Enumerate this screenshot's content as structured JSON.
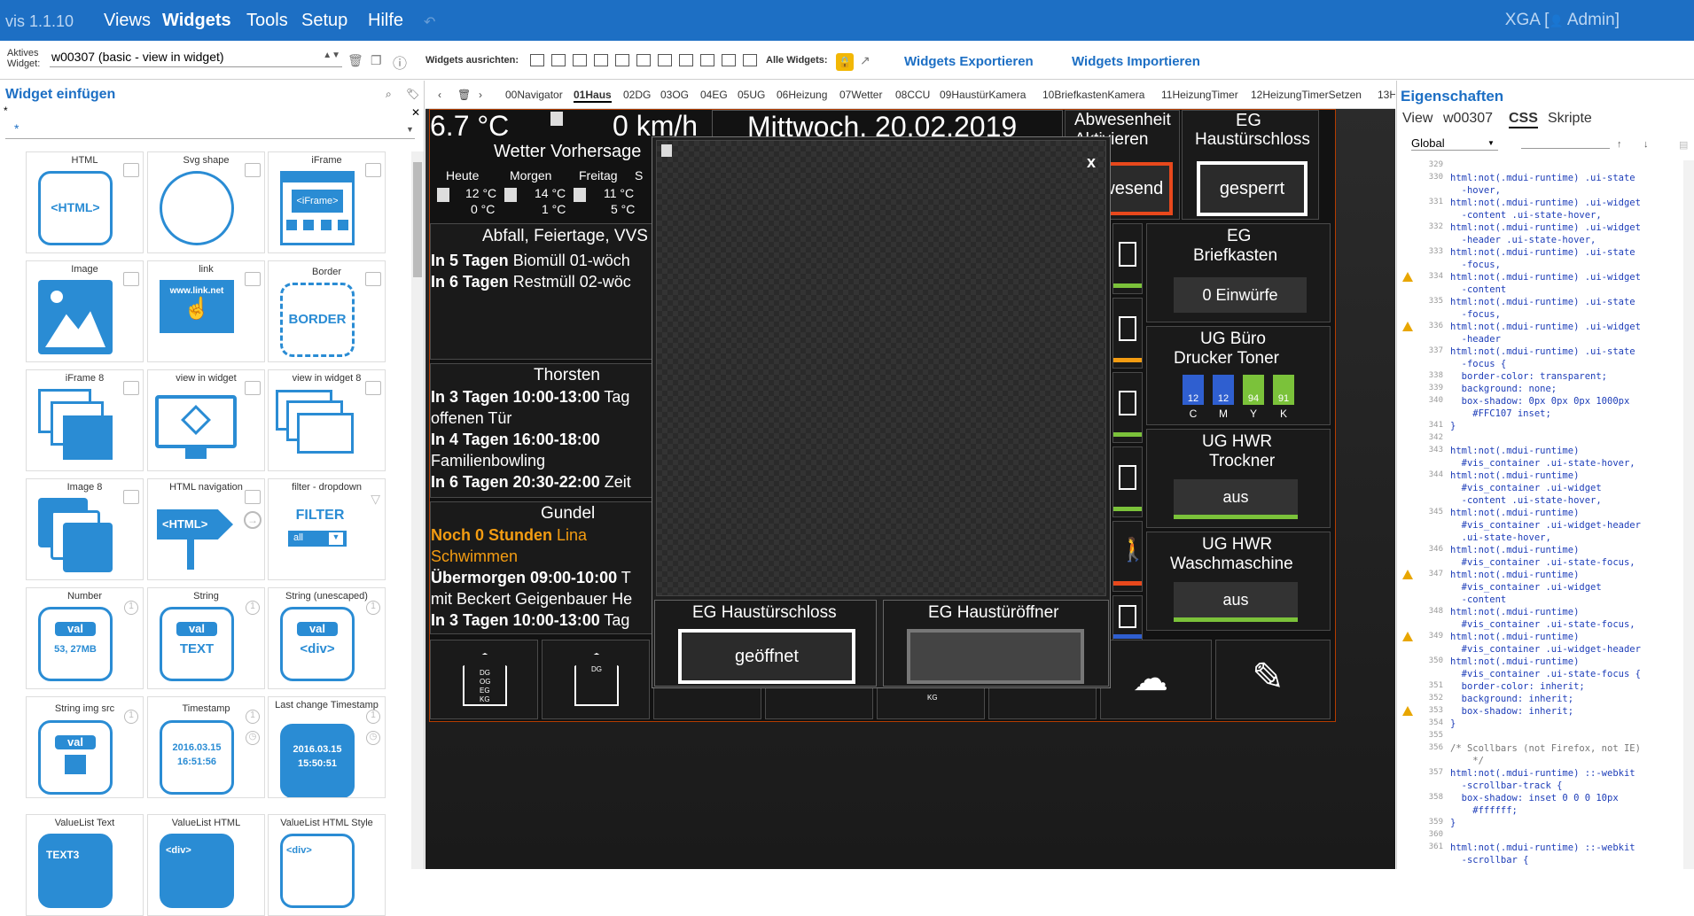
{
  "top": {
    "version": "vis 1.1.10",
    "menu": [
      "Views",
      "Widgets",
      "Tools",
      "Setup",
      "Hilfe"
    ],
    "active_menu": "Widgets",
    "user_prefix": "XGA [",
    "user": "Admin]"
  },
  "toolbar": {
    "active_label_1": "Aktives",
    "active_label_2": "Widget:",
    "active_value": "w00307 (basic - view in widget)",
    "align_label": "Widgets ausrichten:",
    "all_label": "Alle Widgets:",
    "export": "Widgets Exportieren",
    "import": "Widgets Importieren"
  },
  "left": {
    "title": "Widget einfügen",
    "star": "*",
    "filter": "*",
    "widgets": [
      {
        "label": "HTML",
        "content": "<HTML>"
      },
      {
        "label": "Svg shape",
        "content": ""
      },
      {
        "label": "iFrame",
        "content": "<iFrame>"
      },
      {
        "label": "Image",
        "content": ""
      },
      {
        "label": "link",
        "content": "www.link.net"
      },
      {
        "label": "Border",
        "content": "BORDER"
      },
      {
        "label": "iFrame 8",
        "content": ""
      },
      {
        "label": "view in widget",
        "content": ""
      },
      {
        "label": "view in widget 8",
        "content": ""
      },
      {
        "label": "Image 8",
        "content": ""
      },
      {
        "label": "HTML navigation",
        "content": "<HTML>"
      },
      {
        "label": "filter - dropdown",
        "content": "FILTER"
      },
      {
        "label": "Number",
        "pill": "val",
        "content": "53, 27MB"
      },
      {
        "label": "String",
        "pill": "val",
        "content": "TEXT"
      },
      {
        "label": "String (unescaped)",
        "pill": "val",
        "content": "<div>"
      },
      {
        "label": "String img src",
        "pill": "val",
        "content": ""
      },
      {
        "label": "Timestamp",
        "content": "2016.03.15",
        "content2": "16:51:56"
      },
      {
        "label": "Last change Timestamp",
        "content": "2016.03.15",
        "content2": "15:50:51"
      },
      {
        "label": "ValueList Text",
        "content": "TEXT3"
      },
      {
        "label": "ValueList HTML",
        "content": "<div>"
      },
      {
        "label": "ValueList HTML Style",
        "content": "<div>"
      }
    ],
    "filter_all": "all"
  },
  "views": {
    "tabs": [
      "00Navigator",
      "01Haus",
      "02DG",
      "03OG",
      "04EG",
      "05UG",
      "06Heizung",
      "07Wetter",
      "08CCU",
      "09HaustürKamera",
      "10BriefkastenKamera",
      "11HeizungTimer",
      "12HeizungTimerSetzen",
      "13H"
    ],
    "active": "01Haus"
  },
  "dash": {
    "temp": "6.7 °C",
    "wind": "0 km/h",
    "date": "Mittwoch, 20.02.2019",
    "abw_1": "Abwesenheit",
    "abw_2": "Aktivieren",
    "abw_ghost": "Haustürschloss",
    "abw_btn": "Anwesend",
    "eg_1": "EG",
    "eg_2": "Haustürschloss",
    "eg_btn": "gesperrt",
    "weather_title": "Wetter Vorhersage",
    "days": [
      "Heute",
      "Morgen",
      "Freitag",
      "S"
    ],
    "hi": [
      "12 °C",
      "14 °C",
      "11 °C"
    ],
    "lo": [
      "0 °C",
      "1 °C",
      "5 °C"
    ],
    "abfall_title": "Abfall, Feiertage, VVS",
    "abfall": [
      {
        "b": "In 5 Tagen",
        "t": " Biomüll 01-wöch"
      },
      {
        "b": "In 6 Tagen",
        "t": " Restmüll 02-wöc"
      }
    ],
    "thorsten_title": "Thorsten",
    "thorsten": [
      {
        "b": "In 3 Tagen 10:00-13:00",
        "t": " Tag"
      },
      {
        "b": "",
        "t": "offenen Tür"
      },
      {
        "b": "In 4 Tagen 16:00-18:00",
        "t": ""
      },
      {
        "b": "",
        "t": "Familienbowling"
      },
      {
        "b": "In 6 Tagen 20:30-22:00",
        "t": " Zeit"
      }
    ],
    "gundel_title": "Gundel",
    "gundel": [
      {
        "b": "Noch 0 Stunden",
        "t": " Lina",
        "orange": true
      },
      {
        "b": "",
        "t": "Schwimmen",
        "orange": true
      },
      {
        "b": "Übermorgen 09:00-10:00",
        "t": " T"
      },
      {
        "b": "",
        "t": "mit Beckert Geigenbauer He"
      },
      {
        "b": "In 3 Tagen 10:00-13:00",
        "t": " Tag"
      }
    ],
    "brief_1": "EG",
    "brief_2": "Briefkasten",
    "brief_val": "0 Einwürfe",
    "drucker_1": "UG Büro",
    "drucker_2": "Drucker Toner",
    "toner_letters": [
      "C",
      "M",
      "Y",
      "K"
    ],
    "toner_values": [
      "12",
      "12",
      "94",
      "91"
    ],
    "trockner_1": "UG HWR",
    "trockner_2": "Trockner",
    "trockner_val": "aus",
    "wasch_1": "UG HWR",
    "wasch_2": "Waschmaschine",
    "wasch_val": "aus",
    "nav_labels": [
      "DG",
      "OG",
      "EG",
      "KG"
    ],
    "nav_dg": "DG",
    "nav_kg": "KG"
  },
  "popup": {
    "close": "x",
    "left_title": "EG Haustürschloss",
    "left_btn": "geöffnet",
    "right_title": "EG Haustüröffner"
  },
  "props": {
    "title": "Eigenschaften",
    "tabs": [
      "View",
      "w00307",
      "CSS",
      "Skripte"
    ],
    "active_tab": "CSS",
    "scope": "Global",
    "lines": [
      {
        "n": "329",
        "t": ""
      },
      {
        "n": "330",
        "t": "html:not(.mdui-runtime) .ui-state"
      },
      {
        "n": "",
        "t": "  -hover,"
      },
      {
        "n": "331",
        "t": "html:not(.mdui-runtime) .ui-widget"
      },
      {
        "n": "",
        "t": "  -content .ui-state-hover,"
      },
      {
        "n": "332",
        "t": "html:not(.mdui-runtime) .ui-widget"
      },
      {
        "n": "",
        "t": "  -header .ui-state-hover,"
      },
      {
        "n": "333",
        "t": "html:not(.mdui-runtime) .ui-state"
      },
      {
        "n": "",
        "t": "  -focus,"
      },
      {
        "n": "334",
        "t": "html:not(.mdui-runtime) .ui-widget",
        "warn": true
      },
      {
        "n": "",
        "t": "  -content"
      },
      {
        "n": "335",
        "t": "html:not(.mdui-runtime) .ui-state"
      },
      {
        "n": "",
        "t": "  -focus,"
      },
      {
        "n": "336",
        "t": "html:not(.mdui-runtime) .ui-widget",
        "warn": true
      },
      {
        "n": "",
        "t": "  -header"
      },
      {
        "n": "337",
        "t": "html:not(.mdui-runtime) .ui-state"
      },
      {
        "n": "",
        "t": "  -focus {"
      },
      {
        "n": "338",
        "t": "  border-color: transparent;"
      },
      {
        "n": "339",
        "t": "  background: none;"
      },
      {
        "n": "340",
        "t": "  box-shadow: 0px 0px 0px 1000px"
      },
      {
        "n": "",
        "t": "    #FFC107 inset;"
      },
      {
        "n": "341",
        "t": "}"
      },
      {
        "n": "342",
        "t": ""
      },
      {
        "n": "343",
        "t": "html:not(.mdui-runtime)"
      },
      {
        "n": "",
        "t": "  #vis_container .ui-state-hover,"
      },
      {
        "n": "344",
        "t": "html:not(.mdui-runtime)"
      },
      {
        "n": "",
        "t": "  #vis_container .ui-widget"
      },
      {
        "n": "",
        "t": "  -content .ui-state-hover,"
      },
      {
        "n": "345",
        "t": "html:not(.mdui-runtime)"
      },
      {
        "n": "",
        "t": "  #vis_container .ui-widget-header"
      },
      {
        "n": "",
        "t": "  .ui-state-hover,"
      },
      {
        "n": "346",
        "t": "html:not(.mdui-runtime)"
      },
      {
        "n": "",
        "t": "  #vis_container .ui-state-focus,"
      },
      {
        "n": "347",
        "t": "html:not(.mdui-runtime)",
        "warn": true
      },
      {
        "n": "",
        "t": "  #vis_container .ui-widget"
      },
      {
        "n": "",
        "t": "  -content"
      },
      {
        "n": "348",
        "t": "html:not(.mdui-runtime)"
      },
      {
        "n": "",
        "t": "  #vis_container .ui-state-focus,"
      },
      {
        "n": "349",
        "t": "html:not(.mdui-runtime)",
        "warn": true
      },
      {
        "n": "",
        "t": "  #vis_container .ui-widget-header"
      },
      {
        "n": "350",
        "t": "html:not(.mdui-runtime)"
      },
      {
        "n": "",
        "t": "  #vis_container .ui-state-focus {"
      },
      {
        "n": "351",
        "t": "  border-color: inherit;"
      },
      {
        "n": "352",
        "t": "  background: inherit;"
      },
      {
        "n": "353",
        "t": "  box-shadow: inherit;",
        "warn": true
      },
      {
        "n": "354",
        "t": "}"
      },
      {
        "n": "355",
        "t": ""
      },
      {
        "n": "356",
        "t": "/* Scollbars (not Firefox, not IE)"
      },
      {
        "n": "",
        "t": "    */"
      },
      {
        "n": "357",
        "t": "html:not(.mdui-runtime) ::-webkit"
      },
      {
        "n": "",
        "t": "  -scrollbar-track {"
      },
      {
        "n": "358",
        "t": "  box-shadow: inset 0 0 0 10px"
      },
      {
        "n": "",
        "t": "    #ffffff;"
      },
      {
        "n": "359",
        "t": "}"
      },
      {
        "n": "360",
        "t": ""
      },
      {
        "n": "361",
        "t": "html:not(.mdui-runtime) ::-webkit"
      },
      {
        "n": "",
        "t": "  -scrollbar {"
      }
    ]
  },
  "colors": {
    "accent": "#1d6fc4",
    "widget_icon": "#2a8cd4",
    "toner_c": "#2f5fd0",
    "toner_y": "#7bc23a",
    "orange": "#f39c12"
  }
}
